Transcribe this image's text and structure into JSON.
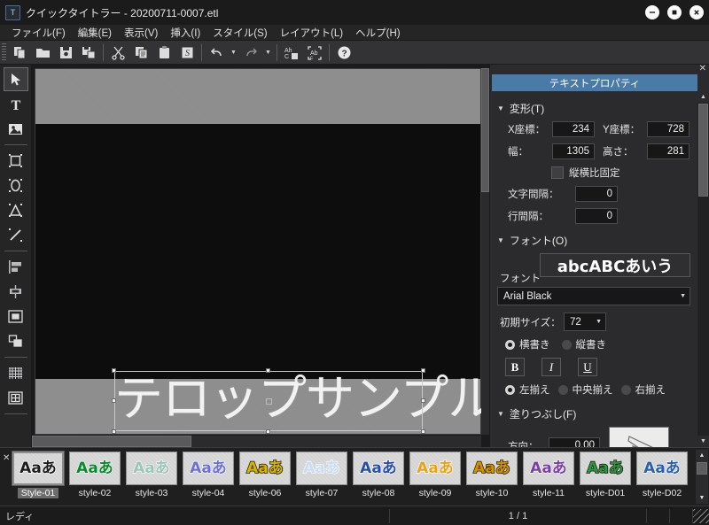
{
  "window": {
    "title": "クイックタイトラー - 20200711-0007.etl",
    "logo_text": "T",
    "minimize": "minimize-icon",
    "maximize": "maximize-icon",
    "close": "close-icon"
  },
  "menubar": [
    {
      "label": "ファイル(F)"
    },
    {
      "label": "編集(E)"
    },
    {
      "label": "表示(V)"
    },
    {
      "label": "挿入(I)"
    },
    {
      "label": "スタイル(S)"
    },
    {
      "label": "レイアウト(L)"
    },
    {
      "label": "ヘルプ(H)"
    }
  ],
  "toolbar": {
    "buttons": [
      {
        "name": "new-icon",
        "glyph": "❐"
      },
      {
        "name": "open-folder-icon",
        "glyph": "📂"
      },
      {
        "name": "save-icon",
        "glyph": "💾"
      },
      {
        "name": "save-as-icon",
        "glyph": "🖫"
      },
      {
        "name": "cut-icon",
        "glyph": "✂"
      },
      {
        "name": "copy-icon",
        "glyph": "⧉"
      },
      {
        "name": "paste-icon",
        "glyph": "📋"
      },
      {
        "name": "style-apply-icon",
        "glyph": "S"
      },
      {
        "name": "undo-icon",
        "glyph": "↰"
      },
      {
        "name": "redo-icon",
        "glyph": "↱"
      },
      {
        "name": "text-replace-icon",
        "glyph": "Ab"
      },
      {
        "name": "text-select-icon",
        "glyph": "ab"
      },
      {
        "name": "help-icon",
        "glyph": "?"
      }
    ]
  },
  "lefttools": [
    {
      "name": "tool-select-arrow",
      "selected": true
    },
    {
      "name": "tool-text",
      "selected": false
    },
    {
      "name": "tool-image",
      "selected": false
    },
    {
      "name": "tool-rectangle",
      "selected": false
    },
    {
      "name": "tool-ellipse",
      "selected": false
    },
    {
      "name": "tool-triangle",
      "selected": false
    },
    {
      "name": "tool-line",
      "selected": false
    },
    {
      "name": "tool-align-left",
      "selected": false
    },
    {
      "name": "tool-align-center-h",
      "selected": false
    },
    {
      "name": "tool-center-object",
      "selected": false
    },
    {
      "name": "tool-order",
      "selected": false
    },
    {
      "name": "tool-grid",
      "selected": false
    },
    {
      "name": "tool-safe-area",
      "selected": false
    }
  ],
  "canvas": {
    "telop_text": "テロップサンプル",
    "background_color": "#0d0d0d",
    "letterbox_color": "#8c8c8c"
  },
  "properties": {
    "panel_title": "テキストプロパティ",
    "close_label": "✕",
    "transform": {
      "section_label": "変形(T)",
      "x_label": "X座標：",
      "x_value": "234",
      "y_label": "Y座標：",
      "y_value": "728",
      "w_label": "幅：",
      "w_value": "1305",
      "h_label": "高さ：",
      "h_value": "281",
      "aspect_label": "縦横比固定",
      "aspect_checked": false,
      "charspace_label": "文字間隔：",
      "charspace_value": "0",
      "linespace_label": "行間隔：",
      "linespace_value": "0"
    },
    "font": {
      "section_label": "フォント(O)",
      "preview_text": "abcABCあいう",
      "font_label": "フォント",
      "font_value": "Arial Black",
      "size_label": "初期サイズ：",
      "size_value": "72",
      "writing": [
        {
          "label": "横書き",
          "selected": true
        },
        {
          "label": "縦書き",
          "selected": false
        }
      ],
      "bold_label": "B",
      "italic_label": "I",
      "underline_label": "U",
      "align": [
        {
          "label": "左揃え",
          "selected": true
        },
        {
          "label": "中央揃え",
          "selected": false
        },
        {
          "label": "右揃え",
          "selected": false
        }
      ]
    },
    "fill": {
      "section_label": "塗りつぶし(F)",
      "direction_label": "方向：",
      "direction_value": "0.00"
    }
  },
  "gallery": {
    "close_label": "✕",
    "items": [
      {
        "label": "Style-01",
        "sample": "Aaあ",
        "color": "#1c1c1c",
        "outline": "#ffffff",
        "selected": true
      },
      {
        "label": "style-02",
        "sample": "Aaあ",
        "color": "#0a8a2f",
        "outline": "#ffffff",
        "selected": false
      },
      {
        "label": "style-03",
        "sample": "Aaあ",
        "color": "#9ac5b8",
        "outline": "#ffffff",
        "selected": false
      },
      {
        "label": "style-04",
        "sample": "Aaあ",
        "color": "#6f6fd6",
        "outline": "#ffffff",
        "selected": false
      },
      {
        "label": "style-06",
        "sample": "Aaあ",
        "color": "#d8b400",
        "outline": "#201800",
        "selected": false
      },
      {
        "label": "style-07",
        "sample": "Aaあ",
        "color": "#c9dcf2",
        "outline": "#ffffff",
        "selected": false
      },
      {
        "label": "style-08",
        "sample": "Aaあ",
        "color": "#2a4fa8",
        "outline": "#ffffff",
        "selected": false
      },
      {
        "label": "style-09",
        "sample": "Aaあ",
        "color": "#e8a317",
        "outline": "#ffffff",
        "selected": false
      },
      {
        "label": "style-10",
        "sample": "Aaあ",
        "color": "#d49400",
        "outline": "#2a1d00",
        "selected": false
      },
      {
        "label": "style-11",
        "sample": "Aaあ",
        "color": "#7b3fa8",
        "outline": "#ffffff",
        "selected": false
      },
      {
        "label": "style-D01",
        "sample": "Aaあ",
        "color": "#2f9340",
        "outline": "#17170f",
        "selected": false
      },
      {
        "label": "style-D02",
        "sample": "Aaあ",
        "color": "#2a5fb0",
        "outline": "#ffffff",
        "selected": false
      }
    ]
  },
  "statusbar": {
    "message": "レディ",
    "page": "1 / 1"
  }
}
